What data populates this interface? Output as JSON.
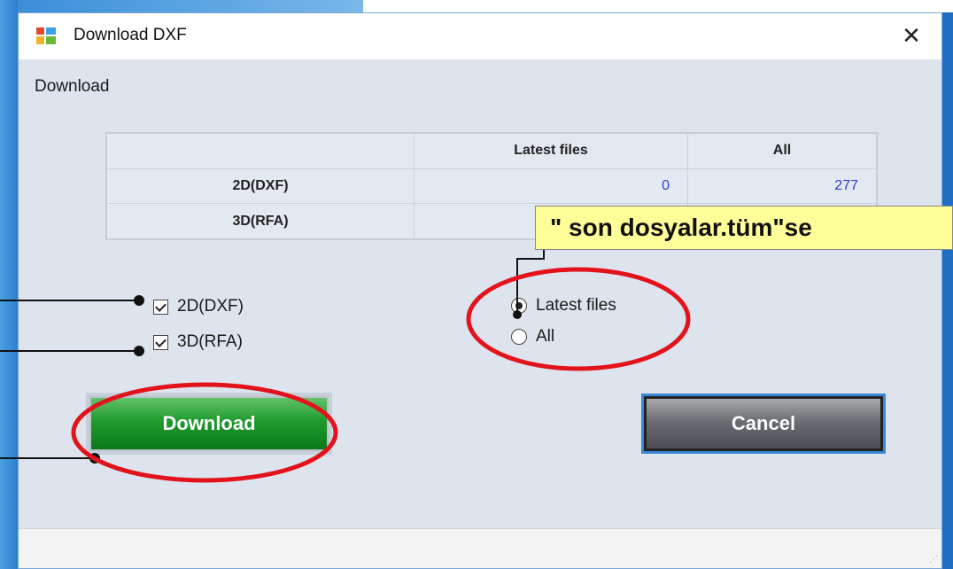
{
  "window": {
    "title": "Download DXF",
    "close_glyph": "✕",
    "section_label": "Download"
  },
  "grid": {
    "headers": [
      "",
      "Latest files",
      "All"
    ],
    "rows": [
      {
        "label": "2D(DXF)",
        "latest": "0",
        "all": "277"
      },
      {
        "label": "3D(RFA)",
        "latest": "",
        "all": ""
      }
    ]
  },
  "options": {
    "checkbox_2d": {
      "label": "2D(DXF)",
      "checked": true
    },
    "checkbox_3d": {
      "label": "3D(RFA)",
      "checked": true
    },
    "radio_latest": {
      "label": "Latest files",
      "selected": true
    },
    "radio_all": {
      "label": "All",
      "selected": false
    }
  },
  "buttons": {
    "download": "Download",
    "cancel": "Cancel"
  },
  "annotation": {
    "callout_text": "\" son dosyalar.tüm\"se",
    "highlight_color": "#e3131b",
    "callout_bg": "#ffff9a"
  },
  "colors": {
    "download_green": "#1f9a2e",
    "cancel_gray": "#6a6d71",
    "value_blue": "#2b3fd4"
  }
}
